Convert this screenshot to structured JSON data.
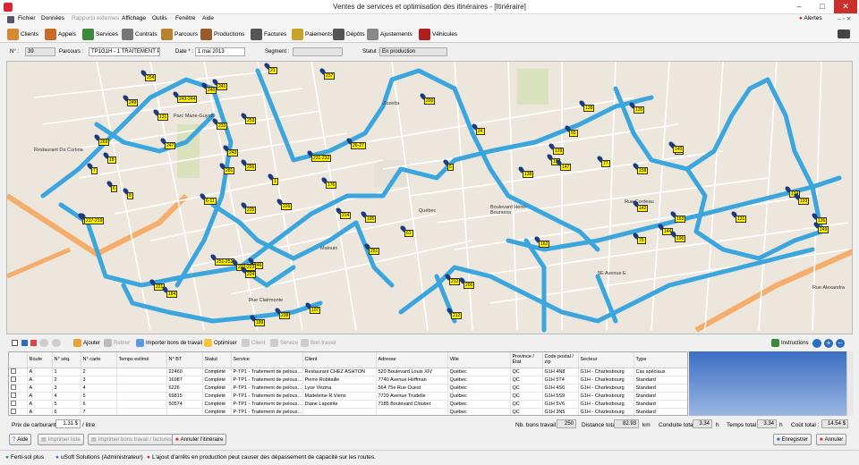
{
  "window": {
    "title": "Ventes de services et optimisation des itinéraires - [Itinéraire]"
  },
  "alerts_label": "Alertes",
  "menu": [
    {
      "label": "Fichier",
      "enabled": true
    },
    {
      "label": "Données",
      "enabled": true
    },
    {
      "label": "Rapports externes",
      "enabled": false
    },
    {
      "label": "Affichage",
      "enabled": true
    },
    {
      "label": "Outils",
      "enabled": true
    },
    {
      "label": "Fenêtre",
      "enabled": true
    },
    {
      "label": "Aide",
      "enabled": true
    }
  ],
  "toolbar": [
    {
      "label": "Clients",
      "icon": "clients-icon",
      "color": "#d88830"
    },
    {
      "label": "Appels",
      "icon": "phone-icon",
      "color": "#c86a2a"
    },
    {
      "label": "Services",
      "icon": "services-icon",
      "color": "#3a8a3a"
    },
    {
      "label": "Contrats",
      "icon": "contract-icon",
      "color": "#777"
    },
    {
      "label": "Parcours",
      "icon": "route-icon",
      "color": "#b9822e"
    },
    {
      "label": "Productions",
      "icon": "production-icon",
      "color": "#9a5b2a"
    },
    {
      "label": "Factures",
      "icon": "invoice-icon",
      "color": "#555"
    },
    {
      "label": "Paiements",
      "icon": "payment-icon",
      "color": "#c9a22b"
    },
    {
      "label": "Dépôts",
      "icon": "deposit-icon",
      "color": "#555"
    },
    {
      "label": "Ajustements",
      "icon": "adjust-icon",
      "color": "#888"
    },
    {
      "label": "Véhicules",
      "icon": "truck-icon",
      "color": "#b01e1e"
    }
  ],
  "form": {
    "no_label": "N° :",
    "no_value": "39",
    "parcours_label": "Parcours :",
    "parcours_value": "TP1G1H - 1 TRAITEMENT PELC",
    "date_label": "Date * :",
    "date_value": "1 mai 2013",
    "segment_label": "Segment :",
    "segment_value": "",
    "statut_label": "Statut :",
    "statut_value": "En production"
  },
  "map": {
    "labels": [
      {
        "t": "Restaurant Da Cortina"
      },
      {
        "t": "Parc Marie-Guyott"
      },
      {
        "t": "Québec"
      },
      {
        "t": "Malouin"
      },
      {
        "t": "Rue Cordeau"
      },
      {
        "t": "Boulevard Henri-Bourassa"
      },
      {
        "t": "Rue Clairmonte"
      },
      {
        "t": "5E Avenue E"
      },
      {
        "t": "Rue Alexandra"
      },
      {
        "t": "Zozetta"
      }
    ],
    "pins": [
      "238",
      "189",
      "237",
      "162",
      "225",
      "269",
      "249",
      "240",
      "243-244",
      "241",
      "253",
      "21",
      "254",
      "247",
      "256",
      "243",
      "281",
      "24",
      "176",
      "233",
      "131",
      "26-27",
      "246",
      "1",
      "5",
      "19",
      "55",
      "77",
      "135",
      "32",
      "217",
      "251-252",
      "231-232",
      "226",
      "214",
      "8",
      "251",
      "61",
      "140",
      "144",
      "163",
      "131",
      "134",
      "136",
      "75",
      "200",
      "142",
      "212",
      "217-219",
      "221",
      "222-223",
      "224",
      "7",
      "6",
      "18",
      "6-11",
      "200",
      "212",
      "195",
      "107",
      "184",
      "193",
      "249",
      "196",
      "147",
      "158",
      "138",
      "139",
      "138"
    ]
  },
  "bottom_toolbar": {
    "ajouter": "Ajouter",
    "retirer": "Retirer",
    "importer": "Importer bons de travail",
    "optimiser": "Optimiser",
    "client": "Client",
    "service": "Service",
    "bon": "Bon travail",
    "instructions": "Instructions"
  },
  "grid": {
    "headers": [
      "Route",
      "N° séq.",
      "N° carte",
      "Temps estimé",
      "N° BT",
      "Statut",
      "Service",
      "Client",
      "Adresse",
      "Ville",
      "Province / État",
      "Code postal / zip",
      "Secteur",
      "Type"
    ],
    "rows": [
      [
        "A",
        "1",
        "2",
        "",
        "22460",
        "Complété",
        "P-TP1 - Traitement de pelous…",
        "Restaurant CHEZ ASHTON",
        "520 Boulevard Louis XIV",
        "Québec",
        "QC",
        "G1H 4N8",
        "G1H - Charlesbourg",
        "Cas spéciaux"
      ],
      [
        "A",
        "2",
        "3",
        "",
        "16987",
        "Complété",
        "P-TP1 - Traitement de pelous…",
        "Pierre Robitaille",
        "7740 Avenue Hoffman",
        "Québec",
        "QC",
        "G1H 5T4",
        "G1H - Charlesbourg",
        "Standard"
      ],
      [
        "A",
        "3",
        "4",
        "",
        "6226",
        "Complété",
        "P-TP1 - Traitement de pelous…",
        "Lyse Vézina",
        "564 75e Rue Ouest",
        "Québec",
        "QC",
        "G1H 4S6",
        "G1H - Charlesbourg",
        "Standard"
      ],
      [
        "A",
        "4",
        "5",
        "",
        "69815",
        "Complété",
        "P-TP1 - Traitement de pelous…",
        "Madeleine R.Viens",
        "7720 Avenue Trudelle",
        "Québec",
        "QC",
        "G1H 5S9",
        "G1H - Charlesbourg",
        "Standard"
      ],
      [
        "A",
        "5",
        "6",
        "",
        "50574",
        "Complété",
        "P-TP1 - Traitement de pelous…",
        "Diane Lapointe",
        "7185 Boulevard Cloutier",
        "Québec",
        "QC",
        "G1H 5V6",
        "G1H - Charlesbourg",
        "Standard"
      ],
      [
        "A",
        "6",
        "7",
        "",
        "",
        "Complété",
        "P-TP1 - Traitement de pelous…",
        "",
        "",
        "Québec",
        "QC",
        "G1H 3N5",
        "G1H - Charlesbourg",
        "Standard"
      ]
    ]
  },
  "footer": {
    "prix_label": "Prix de carburant :",
    "prix_value": "1.31 $",
    "prix_unit": "/ litre",
    "nb_label": "Nb. bons travail :",
    "nb_value": "250",
    "dist_label": "Distance totale :",
    "dist_value": "82.93",
    "dist_unit": "km",
    "cond_label": "Conduite totale :",
    "cond_value": "3.34",
    "cond_unit": "h",
    "temps_label": "Temps total :",
    "temps_value": "3.34",
    "temps_unit": "h",
    "cout_label": "Coût total :",
    "cout_value": "14.54 $"
  },
  "buttons": {
    "aide": "Aide",
    "imprimer_liste": "Imprimer liste",
    "imprimer_bons": "Imprimer bons travail / factures",
    "annuler_itin": "Annuler l'itinéraire",
    "enregistrer": "Enregistrer",
    "annuler": "Annuler"
  },
  "status": {
    "product": "Ferti-sol plus",
    "user": "uSoft Solutions (Administrateur)",
    "message": "L'ajout d'arrêts en production peut causer des dépassement de capacité sur les routes."
  }
}
